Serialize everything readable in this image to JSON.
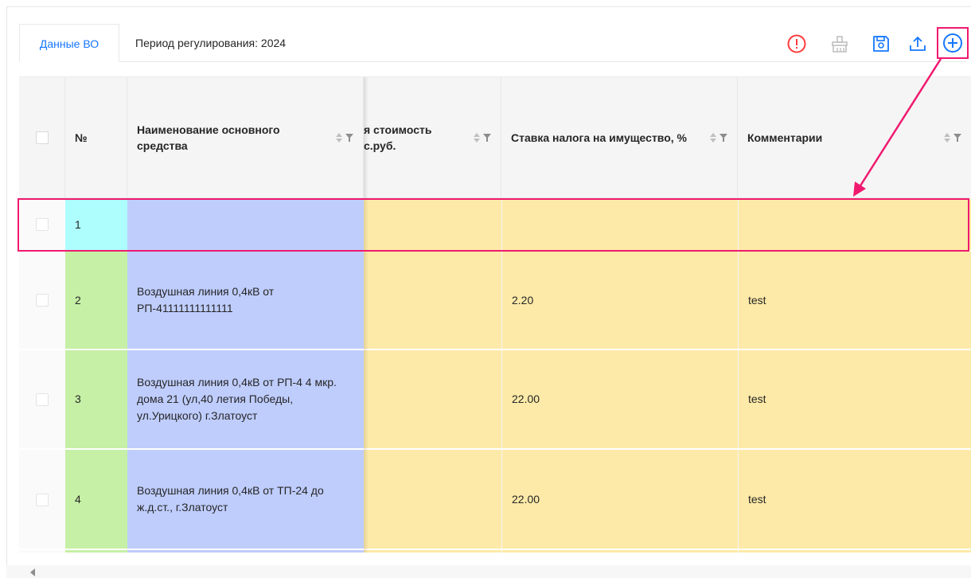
{
  "tabs": {
    "data_tab": "Данные ВО",
    "period_label": "Период регулирования: 2024"
  },
  "toolbar": {
    "icons": [
      "alert-icon",
      "clear-icon",
      "save-icon",
      "upload-icon",
      "add-icon"
    ],
    "accent": "#1677ff",
    "alert_color": "#ff3b3b"
  },
  "table": {
    "columns": {
      "number": "№",
      "name": "Наименование основного средства",
      "cost": "я стоимость с.руб.",
      "cost_line1": "я стоимость",
      "cost_line2": "с.руб.",
      "rate": "Ставка налога на имущество, %",
      "comments": "Комментарии"
    },
    "rows": [
      {
        "num": "1",
        "name": "",
        "cost": "",
        "rate": "",
        "comment": ""
      },
      {
        "num": "2",
        "name": "Воздушная линия 0,4кВ от РП-41111111111111",
        "cost": "",
        "rate": "2.20",
        "comment": "test"
      },
      {
        "num": "3",
        "name": "Воздушная линия 0,4кВ от РП-4 4 мкр. дома 21 (ул,40 летия Победы, ул.Урицкого) г.Златоуст",
        "cost": "",
        "rate": "22.00",
        "comment": "test"
      },
      {
        "num": "4",
        "name": "Воздушная линия 0,4кВ от ТП-24 до ж.д.ст., г.Златоуст",
        "cost": "",
        "rate": "22.00",
        "comment": "test"
      }
    ]
  },
  "colors": {
    "name_column": "#bfcdfd",
    "editable_columns": "#fdeaa8",
    "new_row_number": "#aefefe",
    "existing_row_number": "#c6f0a6",
    "annotation": "#f0196f"
  }
}
